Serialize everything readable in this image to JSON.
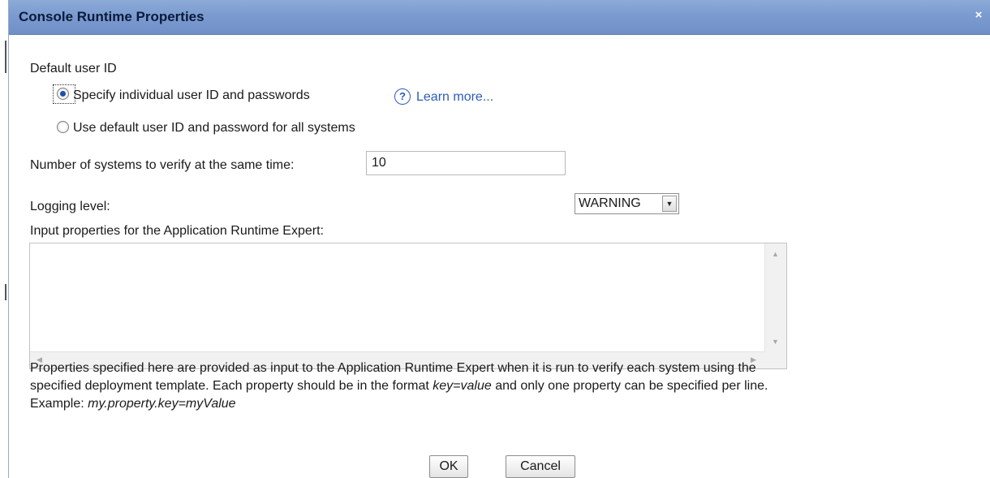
{
  "dialog": {
    "title": "Console Runtime Properties",
    "close_glyph": "×"
  },
  "user_id": {
    "section_label": "Default user ID",
    "options": [
      {
        "label": "Specify individual user ID and passwords",
        "selected": true
      },
      {
        "label": "Use default user ID and password for all systems",
        "selected": false
      }
    ],
    "help_icon_glyph": "?",
    "learn_more": "Learn more..."
  },
  "verify": {
    "label": "Number of systems to verify at the same time:",
    "value": "10"
  },
  "logging": {
    "label": "Logging level:",
    "selected": "WARNING"
  },
  "input_properties": {
    "label": "Input properties for the Application Runtime Expert:",
    "value": ""
  },
  "description": {
    "line1": "Properties specified here are provided as input to the Application Runtime Expert when it is run to verify each system using the",
    "line2_prefix": "specified deployment template. Each property should be in the format ",
    "line2_format": "key=value",
    "line2_suffix": " and only one property can be specified per line.",
    "line3_prefix": "Example: ",
    "line3_example": "my.property.key=myValue"
  },
  "buttons": {
    "ok": "OK",
    "cancel": "Cancel"
  },
  "colors": {
    "titlebar": "#7b9bd0",
    "link": "#2d5bb8",
    "radio_selected": "#1f4fa8"
  },
  "icons": {
    "help": "question-circle-icon",
    "dropdown": "chevron-down-icon",
    "close": "close-icon"
  }
}
